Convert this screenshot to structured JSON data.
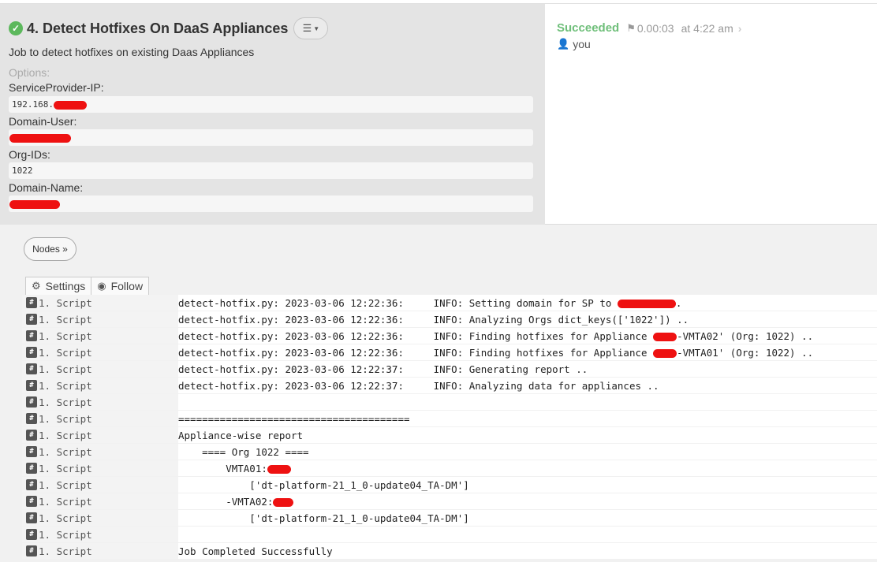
{
  "job": {
    "title": "4. Detect Hotfixes On DaaS Appliances",
    "description": "Job to detect hotfixes on existing Daas Appliances",
    "options_label": "Options:",
    "options": [
      {
        "label": "ServiceProvider-IP:",
        "value": "192.168."
      },
      {
        "label": "Domain-User:",
        "value": ""
      },
      {
        "label": "Org-IDs:",
        "value": "1022"
      },
      {
        "label": "Domain-Name:",
        "value": ""
      }
    ]
  },
  "status": {
    "state": "Succeeded",
    "duration": "0.00:03",
    "time": "at 4:22 am",
    "user": "you",
    "color": "#6fbf7a"
  },
  "nodes_button": "Nodes »",
  "toolbar": {
    "settings_label": "Settings",
    "follow_label": "Follow"
  },
  "log": {
    "step_label": "1. Script",
    "lines": [
      "detect-hotfix.py: 2023-03-06 12:22:36:     INFO: Setting domain for SP to ",
      "detect-hotfix.py: 2023-03-06 12:22:36:     INFO: Analyzing Orgs dict_keys(['1022']) ..",
      "detect-hotfix.py: 2023-03-06 12:22:36:     INFO: Finding hotfixes for Appliance ",
      "detect-hotfix.py: 2023-03-06 12:22:36:     INFO: Finding hotfixes for Appliance ",
      "detect-hotfix.py: 2023-03-06 12:22:37:     INFO: Generating report ..",
      "detect-hotfix.py: 2023-03-06 12:22:37:     INFO: Analyzing data for appliances ..",
      "",
      "=======================================",
      "Appliance-wise report",
      "    ==== Org 1022 ====",
      "        VMTA01:",
      "            ['dt-platform-21_1_0-update04_TA-DM']",
      "        -VMTA02:",
      "            ['dt-platform-21_1_0-update04_TA-DM']",
      "",
      "Job Completed Successfully"
    ],
    "line_suffixes": [
      ".",
      "",
      "-VMTA02' (Org: 1022) ..",
      "-VMTA01' (Org: 1022) ..",
      "",
      "",
      "",
      "",
      "",
      "",
      "",
      "",
      "",
      "",
      "",
      ""
    ]
  }
}
